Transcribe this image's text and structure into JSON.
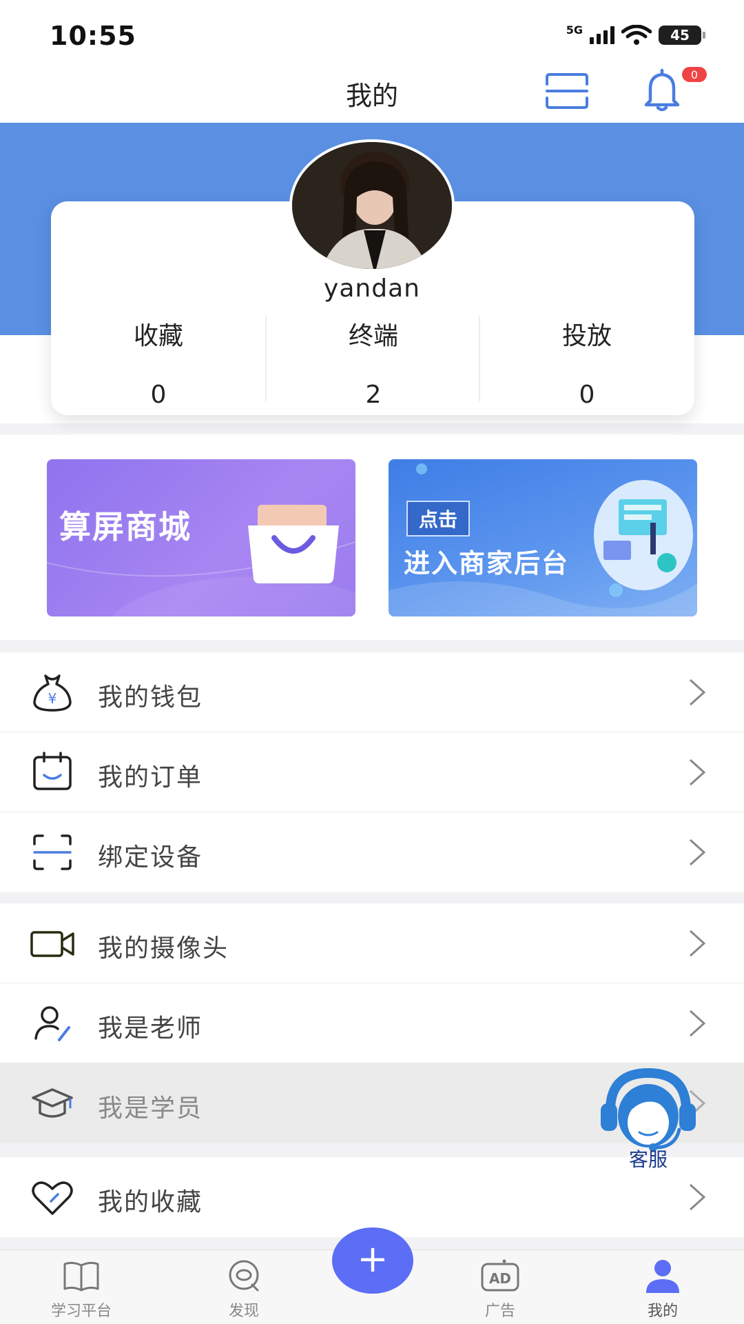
{
  "status_bar": {
    "time": "10:55",
    "network": "5G",
    "battery": "45"
  },
  "nav": {
    "title": "我的",
    "notification_count": "0"
  },
  "profile": {
    "username": "yandan",
    "stats": [
      {
        "label": "收藏",
        "value": "0"
      },
      {
        "label": "终端",
        "value": "2"
      },
      {
        "label": "投放",
        "value": "0"
      }
    ]
  },
  "banners": {
    "mall": {
      "title": "算屏商城"
    },
    "merchant": {
      "tag": "点击",
      "title": "进入商家后台"
    }
  },
  "menu_group_1": [
    {
      "label": "我的钱包",
      "icon": "wallet-icon"
    },
    {
      "label": "我的订单",
      "icon": "order-icon"
    },
    {
      "label": "绑定设备",
      "icon": "scan-device-icon"
    }
  ],
  "menu_group_2": [
    {
      "label": "我的摄像头",
      "icon": "camera-icon"
    },
    {
      "label": "我是老师",
      "icon": "teacher-icon"
    },
    {
      "label": "我是学员",
      "icon": "graduation-cap-icon"
    }
  ],
  "menu_group_3": [
    {
      "label": "我的收藏",
      "icon": "heart-icon"
    }
  ],
  "customer_service": {
    "label": "客服"
  },
  "tab_bar": {
    "tabs": [
      {
        "label": "学习平台",
        "icon": "book-icon"
      },
      {
        "label": "发现",
        "icon": "discover-icon"
      },
      {
        "label": "广告",
        "icon": "ad-icon"
      },
      {
        "label": "我的",
        "icon": "user-icon"
      }
    ],
    "fab_label": "+",
    "active_index": 3
  },
  "colors": {
    "brand_blue": "#5a8fe2",
    "fab": "#5b6ef5",
    "badge": "#f04444",
    "icon_accent": "#4a7de0"
  }
}
